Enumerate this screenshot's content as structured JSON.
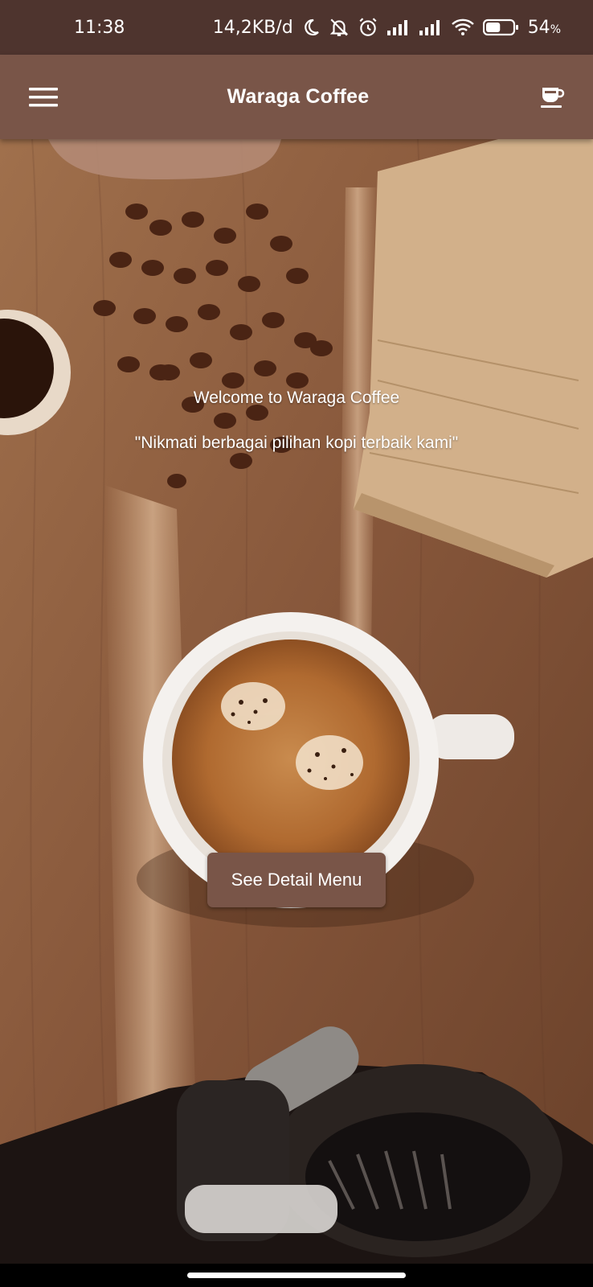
{
  "status_bar": {
    "time": "11:38",
    "network_speed": "14,2KB/d",
    "battery_percent": "54",
    "battery_unit": "%",
    "icons": [
      "moon-icon",
      "bell-off-icon",
      "alarm-icon",
      "signal-1-icon",
      "signal-2-icon",
      "wifi-icon",
      "battery-icon"
    ],
    "battery_level": 0.54
  },
  "app_bar": {
    "title": "Waraga Coffee",
    "menu_icon": "hamburger-menu-icon",
    "action_icon": "coffee-cup-icon",
    "color": "#795548"
  },
  "hero": {
    "welcome": "Welcome to Waraga Coffee",
    "tagline": "\"Nikmati berbagai pilihan kopi terbaik kami\""
  },
  "cta": {
    "label": "See Detail Menu",
    "color": "#795548"
  },
  "theme": {
    "status_bar_color": "#4e342e",
    "primary": "#795548"
  }
}
